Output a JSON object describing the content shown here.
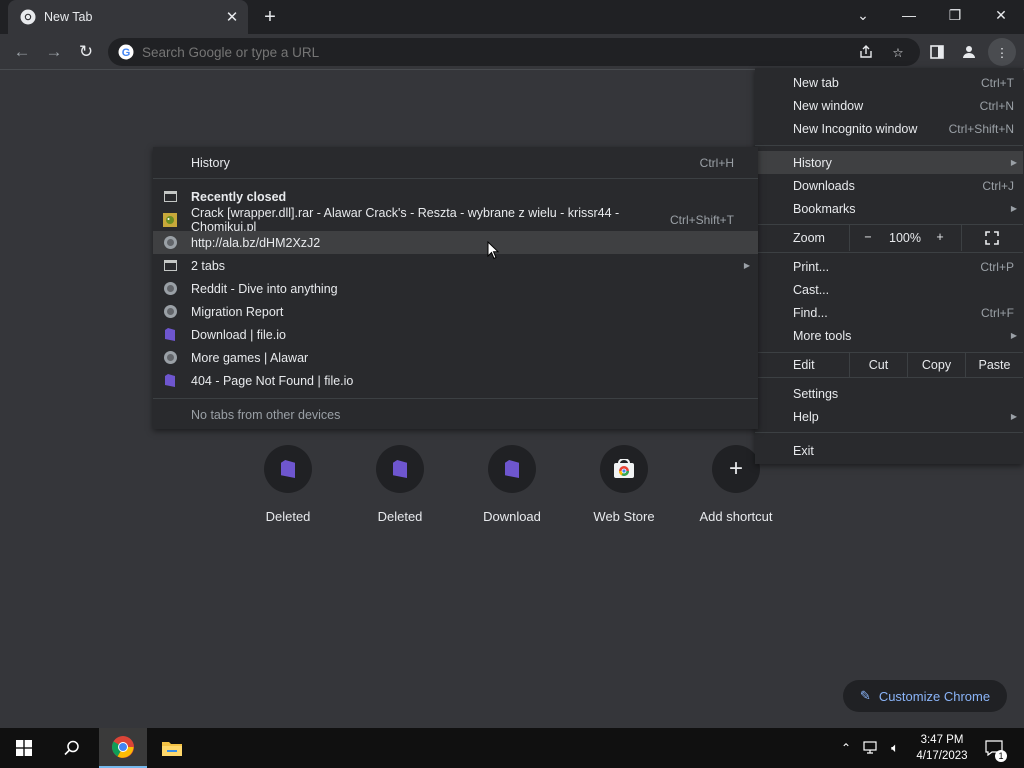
{
  "tab": {
    "title": "New Tab",
    "close_icon": "close-icon",
    "new_tab_icon": "plus-icon"
  },
  "omnibox": {
    "placeholder": "Search Google or type a URL"
  },
  "window_controls": {
    "minimize": "minimize-icon",
    "restore": "restore-icon",
    "close": "close-icon",
    "tab_search": "chevron-down-icon"
  },
  "shortcuts": [
    {
      "label": "Deleted",
      "icon": "fileio-icon"
    },
    {
      "label": "Deleted",
      "icon": "fileio-icon"
    },
    {
      "label": "Download",
      "icon": "fileio-icon"
    },
    {
      "label": "Web Store",
      "icon": "webstore-icon"
    },
    {
      "label": "Add shortcut",
      "icon": "plus-icon"
    }
  ],
  "customize": {
    "label": "Customize Chrome",
    "icon": "pencil-icon"
  },
  "main_menu": {
    "new_tab": {
      "label": "New tab",
      "shortcut": "Ctrl+T"
    },
    "new_window": {
      "label": "New window",
      "shortcut": "Ctrl+N"
    },
    "new_incognito": {
      "label": "New Incognito window",
      "shortcut": "Ctrl+Shift+N"
    },
    "history": {
      "label": "History"
    },
    "downloads": {
      "label": "Downloads",
      "shortcut": "Ctrl+J"
    },
    "bookmarks": {
      "label": "Bookmarks"
    },
    "zoom": {
      "label": "Zoom",
      "minus": "−",
      "value": "100%",
      "plus": "+"
    },
    "print": {
      "label": "Print...",
      "shortcut": "Ctrl+P"
    },
    "cast": {
      "label": "Cast..."
    },
    "find": {
      "label": "Find...",
      "shortcut": "Ctrl+F"
    },
    "more_tools": {
      "label": "More tools"
    },
    "edit": {
      "label": "Edit",
      "cut": "Cut",
      "copy": "Copy",
      "paste": "Paste"
    },
    "settings": {
      "label": "Settings"
    },
    "help": {
      "label": "Help"
    },
    "exit": {
      "label": "Exit"
    }
  },
  "history_menu": {
    "history": {
      "label": "History",
      "shortcut": "Ctrl+H"
    },
    "recently_closed": "Recently closed",
    "items": [
      {
        "label": "Crack [wrapper.dll].rar - Alawar Crack's - Reszta - wybrane z wielu - krissr44 - Chomikuj.pl",
        "shortcut": "Ctrl+Shift+T",
        "icon": "chomikuj-icon"
      },
      {
        "label": "http://ala.bz/dHM2XzJ2",
        "shortcut": "",
        "icon": "globe-icon"
      },
      {
        "label": "2 tabs",
        "shortcut": "",
        "icon": "window-icon"
      },
      {
        "label": "Reddit - Dive into anything",
        "shortcut": "",
        "icon": "globe-icon"
      },
      {
        "label": "Migration Report",
        "shortcut": "",
        "icon": "globe-icon"
      },
      {
        "label": "Download | file.io",
        "shortcut": "",
        "icon": "fileio-icon"
      },
      {
        "label": "More games | Alawar",
        "shortcut": "",
        "icon": "globe-icon"
      },
      {
        "label": "404 - Page Not Found | file.io",
        "shortcut": "",
        "icon": "fileio-icon"
      }
    ],
    "no_tabs": "No tabs from other devices"
  },
  "taskbar": {
    "time": "3:47 PM",
    "date": "4/17/2023",
    "notification_count": "1"
  },
  "colors": {
    "accent": "#8ab4f8",
    "menu_bg": "#292a2d",
    "page_bg": "#35363a",
    "highlight": "#3f4042"
  }
}
